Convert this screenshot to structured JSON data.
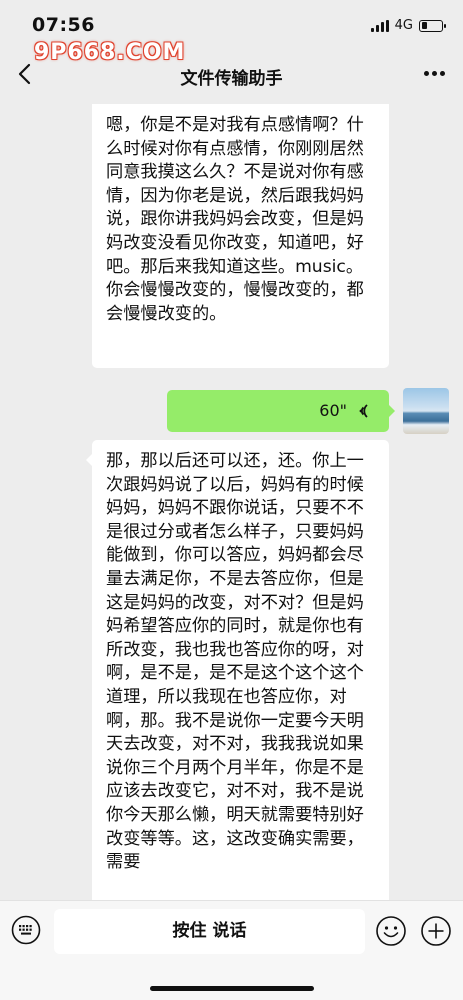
{
  "status_bar": {
    "time": "07:56",
    "network": "4G"
  },
  "watermark": {
    "text": "9P668.COM"
  },
  "nav": {
    "title": "文件传输助手"
  },
  "messages": [
    {
      "type": "text",
      "side": "left",
      "text": "嗯，你是不是对我有点感情啊？什么时候对你有点感情，你刚刚居然同意我摸这么久？不是说对你有感情，因为你老是说，然后跟我妈妈说，跟你讲我妈妈会改变，但是妈妈改变没看见你改变，知道吧，好吧。那后来我知道这些。music。你会慢慢改变的，慢慢改变的，都会慢慢改变的。"
    },
    {
      "type": "voice",
      "side": "right",
      "duration": "60\""
    },
    {
      "type": "text",
      "side": "left",
      "text": "那，那以后还可以还，还。你上一次跟妈妈说了以后，妈妈有的时候妈妈，妈妈不跟你说话，只要不不是很过分或者怎么样子，只要妈妈能做到，你可以答应，妈妈都会尽量去满足你，不是去答应你，但是这是妈妈的改变，对不对？但是妈妈希望答应你的同时，就是你也有所改变，我也我也答应你的呀，对啊，是不是，是不是这个这个这个道理，所以我现在也答应你，对啊，那。我不是说你一定要今天明天去改变，对不对，我我我说如果说你三个月两个月半年，你是不是应该去改变它，对不对，我不是说你今天那么懒，明天就需要特别好改变等等。这，这改变确实需要，需要"
    }
  ],
  "input_bar": {
    "hold_to_talk": "按住 说话"
  },
  "colors": {
    "background": "#ededed",
    "voice_bubble": "#95ec69",
    "text_bubble": "#ffffff"
  }
}
